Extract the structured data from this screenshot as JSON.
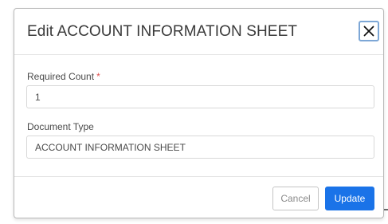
{
  "dialog": {
    "title": "Edit ACCOUNT INFORMATION SHEET",
    "close_icon": "close-icon"
  },
  "fields": {
    "required_count": {
      "label": "Required Count",
      "required_marker": "*",
      "value": "1"
    },
    "document_type": {
      "label": "Document Type",
      "value": "ACCOUNT INFORMATION SHEET"
    }
  },
  "footer": {
    "cancel_label": "Cancel",
    "update_label": "Update"
  },
  "colors": {
    "primary": "#1a73e8",
    "required_star": "#e0514f",
    "close_focus_ring": "#7da7d6"
  }
}
